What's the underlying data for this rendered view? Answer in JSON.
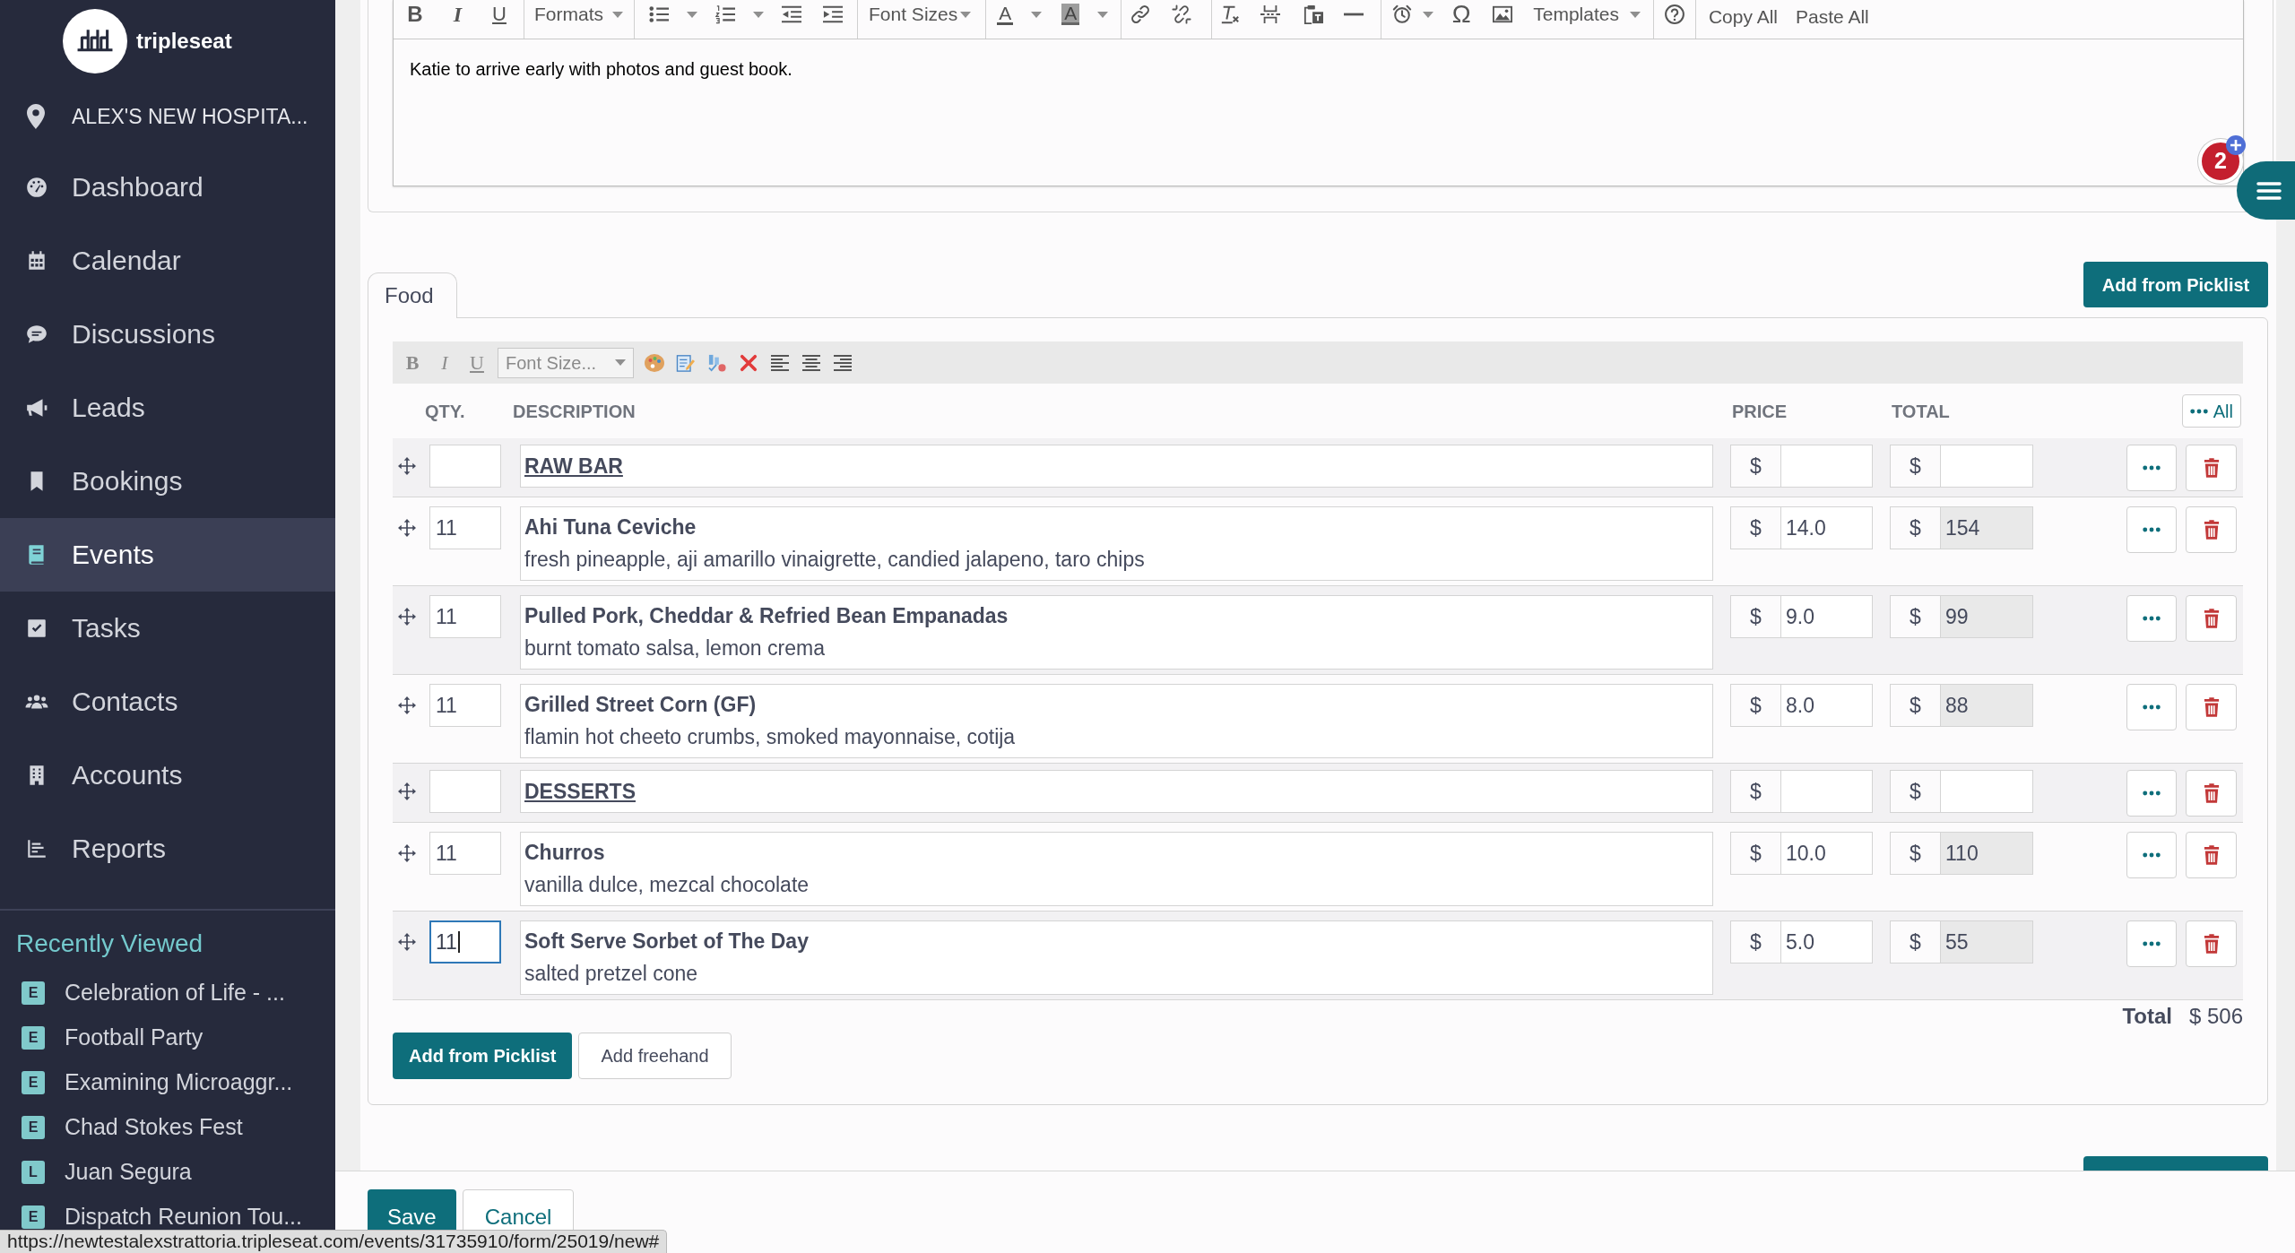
{
  "sidebar": {
    "brand": "tripleseat",
    "location": "ALEX'S NEW HOSPITA...",
    "nav": [
      {
        "label": "Dashboard",
        "selected": false
      },
      {
        "label": "Calendar",
        "selected": false
      },
      {
        "label": "Discussions",
        "selected": false
      },
      {
        "label": "Leads",
        "selected": false
      },
      {
        "label": "Bookings",
        "selected": false
      },
      {
        "label": "Events",
        "selected": true
      },
      {
        "label": "Tasks",
        "selected": false
      },
      {
        "label": "Contacts",
        "selected": false
      },
      {
        "label": "Accounts",
        "selected": false
      },
      {
        "label": "Reports",
        "selected": false
      }
    ],
    "recently_viewed": {
      "title": "Recently Viewed",
      "items": [
        {
          "badge": "E",
          "label": "Celebration of Life - ..."
        },
        {
          "badge": "E",
          "label": "Football Party"
        },
        {
          "badge": "E",
          "label": "Examining Microaggr..."
        },
        {
          "badge": "E",
          "label": "Chad Stokes Fest"
        },
        {
          "badge": "L",
          "label": "Juan Segura"
        },
        {
          "badge": "E",
          "label": "Dispatch Reunion Tou..."
        }
      ]
    }
  },
  "notes_editor": {
    "toolbar": {
      "format_buttons": [
        "B",
        "I",
        "U"
      ],
      "formats": "Formats",
      "font_sizes": "Font Sizes",
      "text_color": "A",
      "background_color": "A",
      "special_character": "Ω",
      "templates": "Templates",
      "copy_all": "Copy All",
      "paste_all": "Paste All"
    },
    "text": "Katie to arrive early with photos and guest book."
  },
  "notification_badge": "2",
  "food": {
    "tab": "Food",
    "add_button": "Add from Picklist",
    "mini_toolbar": {
      "format_buttons": [
        "B",
        "I",
        "U"
      ],
      "font_size": "Font Size..."
    },
    "columns": [
      "QTY.",
      "DESCRIPTION",
      "PRICE",
      "TOTAL"
    ],
    "all_button": "All",
    "rows": [
      {
        "kind": "section",
        "focused": false,
        "title": "RAW BAR",
        "price": {
          "currency": "$"
        },
        "total": {
          "currency": "$"
        }
      },
      {
        "kind": "item",
        "focused": false,
        "qty": "11",
        "name": "Ahi Tuna Ceviche",
        "description": "fresh pineapple, aji amarillo vinaigrette, candied jalapeno, taro chips",
        "price": {
          "currency": "$",
          "value": "14.0"
        },
        "total": {
          "currency": "$",
          "value": "154"
        }
      },
      {
        "kind": "item",
        "focused": false,
        "qty": "11",
        "name": "Pulled Pork, Cheddar & Refried Bean Empanadas",
        "description": "burnt tomato salsa, lemon crema",
        "price": {
          "currency": "$",
          "value": "9.0"
        },
        "total": {
          "currency": "$",
          "value": "99"
        }
      },
      {
        "kind": "item",
        "focused": false,
        "qty": "11",
        "name": "Grilled Street Corn (GF)",
        "description": "flamin hot cheeto crumbs, smoked mayonnaise, cotija",
        "price": {
          "currency": "$",
          "value": "8.0"
        },
        "total": {
          "currency": "$",
          "value": "88"
        }
      },
      {
        "kind": "section",
        "focused": false,
        "title": "DESSERTS",
        "price": {
          "currency": "$"
        },
        "total": {
          "currency": "$"
        }
      },
      {
        "kind": "item",
        "focused": false,
        "qty": "11",
        "name": "Churros",
        "description": "vanilla dulce, mezcal chocolate",
        "price": {
          "currency": "$",
          "value": "10.0"
        },
        "total": {
          "currency": "$",
          "value": "110"
        }
      },
      {
        "kind": "item",
        "focused": true,
        "qty": "11",
        "name": "Soft Serve Sorbet of The Day",
        "description": "salted pretzel cone",
        "price": {
          "currency": "$",
          "value": "5.0"
        },
        "total": {
          "currency": "$",
          "value": "55"
        }
      }
    ],
    "total_label": "Total",
    "total_value": "$ 506",
    "buttons": [
      {
        "label": "Add from Picklist",
        "kind": "primary"
      },
      {
        "label": "Add freehand",
        "kind": "secondary"
      }
    ]
  },
  "footer": {
    "buttons": [
      {
        "label": "Save",
        "kind": "primary"
      },
      {
        "label": "Cancel",
        "kind": "secondary"
      }
    ]
  },
  "status_bar": "https://newtestalexstrattoria.tripleseat.com/events/31735910/form/25019/new#"
}
